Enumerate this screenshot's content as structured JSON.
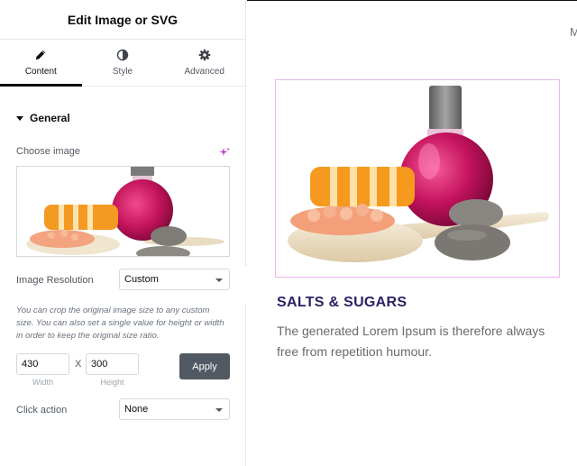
{
  "panel": {
    "title": "Edit Image or SVG",
    "tabs": [
      {
        "label": "Content",
        "icon": "pencil-icon",
        "active": true
      },
      {
        "label": "Style",
        "icon": "contrast-icon",
        "active": false
      },
      {
        "label": "Advanced",
        "icon": "gear-icon",
        "active": false
      }
    ],
    "section_title": "General",
    "choose_image_label": "Choose image",
    "image_resolution": {
      "label": "Image Resolution",
      "value": "Custom"
    },
    "help_text": "You can crop the original image size to any custom size. You can also set a single value for height or width in order to keep the original size ratio.",
    "width": {
      "value": "430",
      "label": "Width"
    },
    "height": {
      "value": "300",
      "label": "Height"
    },
    "separator": "X",
    "apply_label": "Apply",
    "click_action": {
      "label": "Click action",
      "value": "None"
    }
  },
  "canvas": {
    "nav_fragment": "M",
    "heading": "SALTS & SUGARS",
    "body": "The generated Lorem Ipsum is therefore always free from repetition humour."
  },
  "colors": {
    "accent_ai": "#c13fd1",
    "apply_bg": "#515962",
    "heading": "#2d2262",
    "image_frame_border": "#e9b6ee"
  }
}
